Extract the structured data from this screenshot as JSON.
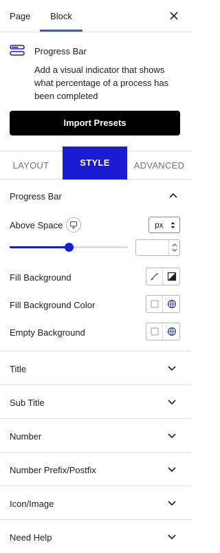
{
  "top_tabs": {
    "page": "Page",
    "block": "Block"
  },
  "block": {
    "name": "Progress Bar",
    "description": "Add a visual indicator that shows what percentage of a process has been completed",
    "import_button": "Import Presets"
  },
  "style_tabs": {
    "layout": "LAYOUT",
    "style": "STYLE",
    "advanced": "ADVANCED"
  },
  "panel": {
    "title": "Progress Bar",
    "above_space": {
      "label": "Above Space",
      "unit": "px",
      "value": "",
      "slider_fraction": 0.5
    },
    "fill_background": "Fill Background",
    "fill_background_color": "Fill Background Color",
    "empty_background": "Empty Background"
  },
  "sections": [
    {
      "title": "Title"
    },
    {
      "title": "Sub Title"
    },
    {
      "title": "Number"
    },
    {
      "title": "Number Prefix/Postfix"
    },
    {
      "title": "Icon/Image"
    },
    {
      "title": "Need Help"
    }
  ],
  "colors": {
    "accent": "#1b1bd1",
    "tab_underline": "#2f5fbf",
    "button_bg": "#000000"
  }
}
